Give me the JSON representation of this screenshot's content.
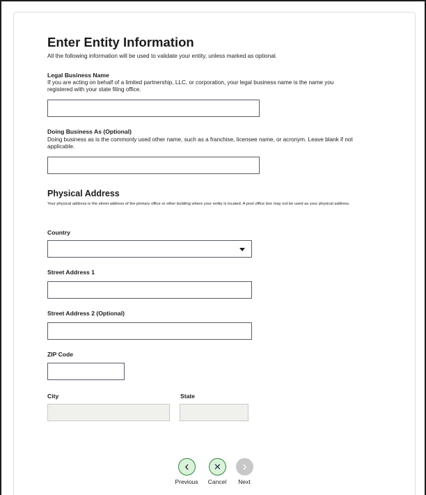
{
  "form": {
    "title": "Enter Entity Information",
    "subtitle": "All the following information will be used to validate your entity, unless marked as optional."
  },
  "legal_business_name": {
    "label": "Legal Business Name",
    "hint": "If you are acting on behalf of a limited partnership, LLC, or corporation, your legal business name is the name you registered with your state filing office.",
    "value": ""
  },
  "doing_business_as": {
    "label": "Doing Business As (Optional)",
    "hint": "Doing business as is the commonly used other name, such as a franchise, licensee name, or acronym. Leave blank if not applicable.",
    "value": ""
  },
  "physical_address": {
    "heading": "Physical Address",
    "hint": "Your physical address is the street address of the primary office or other building where your entity is located. A post office box may not be used as your physical address.",
    "country": {
      "label": "Country",
      "value": ""
    },
    "street1": {
      "label": "Street Address 1",
      "value": ""
    },
    "street2": {
      "label": "Street Address 2 (Optional)",
      "value": ""
    },
    "zip": {
      "label": "ZIP Code",
      "value": ""
    },
    "city": {
      "label": "City",
      "value": ""
    },
    "state": {
      "label": "State",
      "value": ""
    }
  },
  "navigation": {
    "previous": {
      "label": "Previous",
      "icon": "chevron-left-icon",
      "glyph": "‹"
    },
    "cancel": {
      "label": "Cancel",
      "icon": "close-icon",
      "glyph": "✕"
    },
    "next": {
      "label": "Next",
      "icon": "chevron-right-icon",
      "glyph": "›"
    }
  },
  "colors": {
    "active_button_fill": "#d9f2d9",
    "active_button_border": "#2e8540",
    "disabled_button": "#c8c8c8",
    "disabled_field": "#f0f0ec"
  }
}
